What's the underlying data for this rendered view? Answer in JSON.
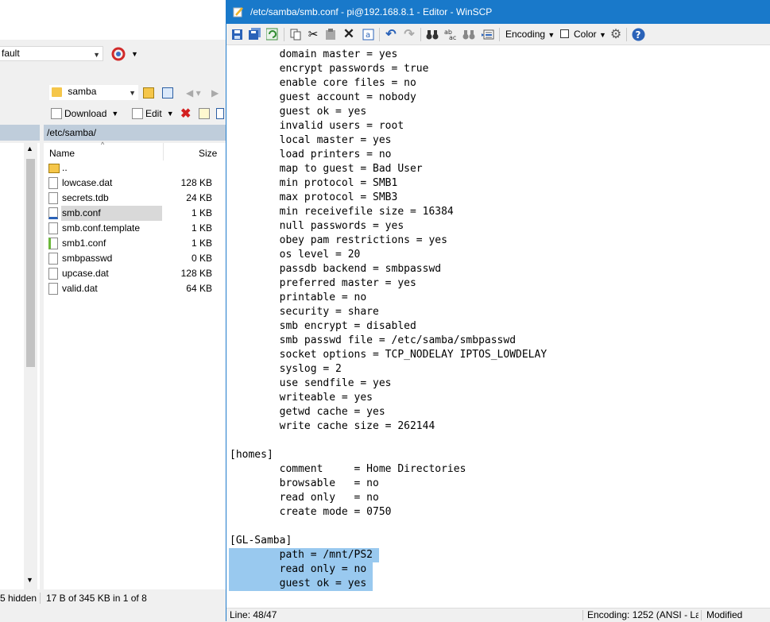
{
  "background_window": {
    "session_dropdown": "fault",
    "path_dropdown": "samba",
    "toolbar": {
      "download_label": "Download",
      "edit_label": "Edit"
    },
    "remote_path": "/etc/samba/",
    "columns": {
      "name": "Name",
      "size": "Size"
    },
    "files": [
      {
        "name": "..",
        "size": "",
        "icon": "parent-folder-icon"
      },
      {
        "name": "lowcase.dat",
        "size": "128 KB",
        "icon": "file-icon"
      },
      {
        "name": "secrets.tdb",
        "size": "24 KB",
        "icon": "file-icon"
      },
      {
        "name": "smb.conf",
        "size": "1 KB",
        "icon": "edit-file-icon",
        "selected": true
      },
      {
        "name": "smb.conf.template",
        "size": "1 KB",
        "icon": "file-icon"
      },
      {
        "name": "smb1.conf",
        "size": "1 KB",
        "icon": "text-file-icon"
      },
      {
        "name": "smbpasswd",
        "size": "0 KB",
        "icon": "file-icon"
      },
      {
        "name": "upcase.dat",
        "size": "128 KB",
        "icon": "file-icon"
      },
      {
        "name": "valid.dat",
        "size": "64 KB",
        "icon": "file-icon"
      }
    ],
    "status": {
      "hidden": "5 hidden",
      "selection": "17 B of 345 KB in 1 of 8"
    }
  },
  "editor": {
    "title": "/etc/samba/smb.conf - pi@192.168.8.1 - Editor - WinSCP",
    "toolbar": {
      "encoding_label": "Encoding",
      "color_label": "Color"
    },
    "lines": [
      "        domain master = yes",
      "        encrypt passwords = true",
      "        enable core files = no",
      "        guest account = nobody",
      "        guest ok = yes",
      "        invalid users = root",
      "        local master = yes",
      "        load printers = no",
      "        map to guest = Bad User",
      "        min protocol = SMB1",
      "        max protocol = SMB3",
      "        min receivefile size = 16384",
      "        null passwords = yes",
      "        obey pam restrictions = yes",
      "        os level = 20",
      "        passdb backend = smbpasswd",
      "        preferred master = yes",
      "        printable = no",
      "        security = share",
      "        smb encrypt = disabled",
      "        smb passwd file = /etc/samba/smbpasswd",
      "        socket options = TCP_NODELAY IPTOS_LOWDELAY",
      "        syslog = 2",
      "        use sendfile = yes",
      "        writeable = yes",
      "        getwd cache = yes",
      "        write cache size = 262144",
      "",
      "[homes]",
      "        comment     = Home Directories",
      "        browsable   = no",
      "        read only   = no",
      "        create mode = 0750",
      "",
      "[GL-Samba]",
      "        path = /mnt/PS2",
      "        read only = no",
      "        guest ok = yes"
    ],
    "status": {
      "line": "Line: 48/47",
      "encoding": "Encoding: 1252  (ANSI - La",
      "modified": "Modified"
    }
  }
}
